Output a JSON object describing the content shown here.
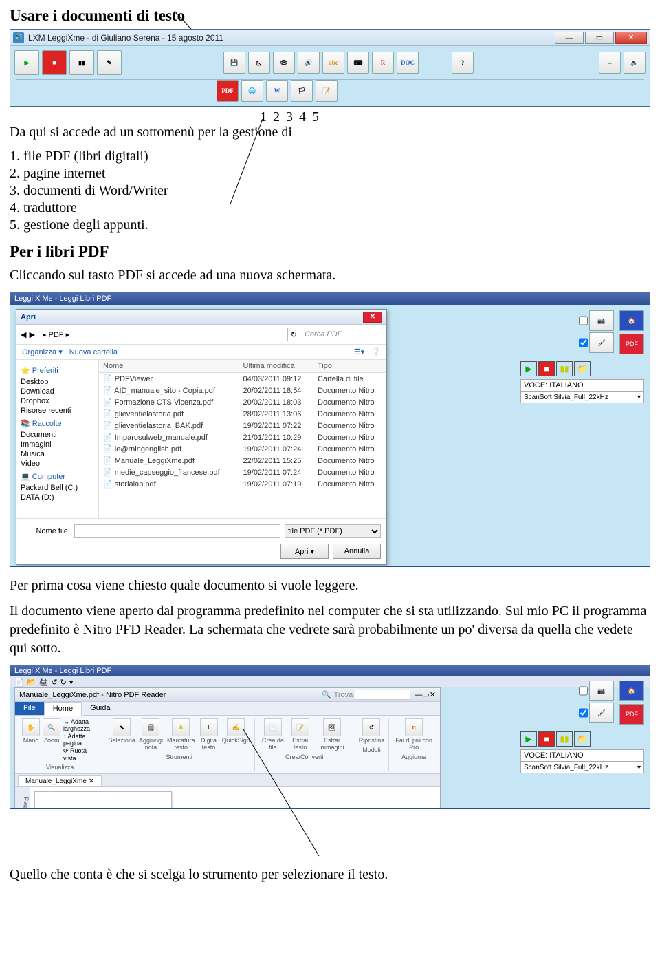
{
  "title": "Usare i documenti di testo",
  "win1": {
    "title": "LXM  LeggiXme - di Giuliano Serena - 15 agosto 2011"
  },
  "numbers_row": "1     2     3     4     5",
  "intro_line": "Da qui si accede ad un sottomenù per la gestione di",
  "items": [
    "1. file PDF (libri digitali)",
    "2. pagine internet",
    "3. documenti di Word/Writer",
    "4. traduttore",
    "5. gestione degli appunti."
  ],
  "sub1": "Per i libri PDF",
  "para1": "Cliccando sul tasto PDF si accede ad una nuova schermata.",
  "shot2": {
    "bar": "Leggi X Me - Leggi Libri PDF",
    "dlg_title": "Apri",
    "path": "▸ PDF ▸",
    "search_ph": "Cerca PDF",
    "tb1": "Organizza ▾",
    "tb2": "Nuova cartella",
    "nav": {
      "fav": "Preferiti",
      "fav_items": [
        "Desktop",
        "Download",
        "Dropbox",
        "Risorse recenti"
      ],
      "lib": "Raccolte",
      "lib_items": [
        "Documenti",
        "Immagini",
        "Musica",
        "Video"
      ],
      "comp": "Computer",
      "comp_items": [
        "Packard Bell (C:)",
        "DATA (D:)"
      ]
    },
    "cols": [
      "Nome",
      "Ultima modifica",
      "Tipo"
    ],
    "rows": [
      [
        "PDFViewer",
        "04/03/2011 09:12",
        "Cartella di file"
      ],
      [
        "AID_manuale_sito - Copia.pdf",
        "20/02/2011 18:54",
        "Documento Nitro"
      ],
      [
        "Formazione CTS Vicenza.pdf",
        "20/02/2011 18:03",
        "Documento Nitro"
      ],
      [
        "glieventielastoria.pdf",
        "28/02/2011 13:06",
        "Documento Nitro"
      ],
      [
        "glieventielastoria_BAK.pdf",
        "19/02/2011 07:22",
        "Documento Nitro"
      ],
      [
        "Imparosulweb_manuale.pdf",
        "21/01/2011 10:29",
        "Documento Nitro"
      ],
      [
        "le@rningenglish.pdf",
        "19/02/2011 07:24",
        "Documento Nitro"
      ],
      [
        "Manuale_LeggiXme.pdf",
        "22/02/2011 15:25",
        "Documento Nitro"
      ],
      [
        "medie_capseggio_francese.pdf",
        "19/02/2011 07:24",
        "Documento Nitro"
      ],
      [
        "storialab.pdf",
        "19/02/2011 07:19",
        "Documento Nitro"
      ]
    ],
    "fname_lbl": "Nome file:",
    "filter": "file PDF (*.PDF)",
    "btn_open": "Apri",
    "btn_cancel": "Annulla",
    "voce_lbl": "VOCE:   ITALIANO",
    "voce_sel": "ScanSoft Silvia_Full_22kHz"
  },
  "para2": "Per prima cosa viene chiesto quale documento si vuole leggere.",
  "para3": "Il documento viene aperto dal programma predefinito nel computer che si sta utilizzando. Sul mio PC il programma predefinito è Nitro PFD  Reader. La schermata che vedrete sarà probabilmente un po' diversa da quella che vedete qui sotto.",
  "shot3": {
    "bar": "Leggi X Me - Leggi Libri PDF",
    "inner_title": "Manuale_LeggiXme.pdf - Nitro PDF Reader",
    "trova": "Trova",
    "tab_file": "File",
    "tab_home": "Home",
    "tab_guida": "Guida",
    "group_view": "Visualizza",
    "group_tools": "Strumenti",
    "group_conv": "Crea/Converti",
    "group_mod": "Moduli",
    "group_upd": "Aggiorna",
    "btn_mano": "Mano",
    "btn_zoom": "Zoom",
    "opt_adatta_l": "Adatta larghezza",
    "opt_adatta_p": "Adatta pagina",
    "opt_ruota": "Ruota vista",
    "btn_sel": "Seleziona",
    "btn_nota": "Aggiungi nota",
    "btn_mark": "Marcatura testo",
    "btn_digit": "Digita testo",
    "btn_qsign": "QuickSign",
    "btn_crea": "Crea da file",
    "btn_etesto": "Estrai testo",
    "btn_eimg": "Estrai immagini",
    "btn_ripr": "Ripristina",
    "btn_faidi": "Fai di più con Pro",
    "doc_tab": "Manuale_LeggiXme",
    "pager": "Pagine"
  },
  "para4": "Quello che conta è che si scelga lo strumento per selezionare il testo."
}
